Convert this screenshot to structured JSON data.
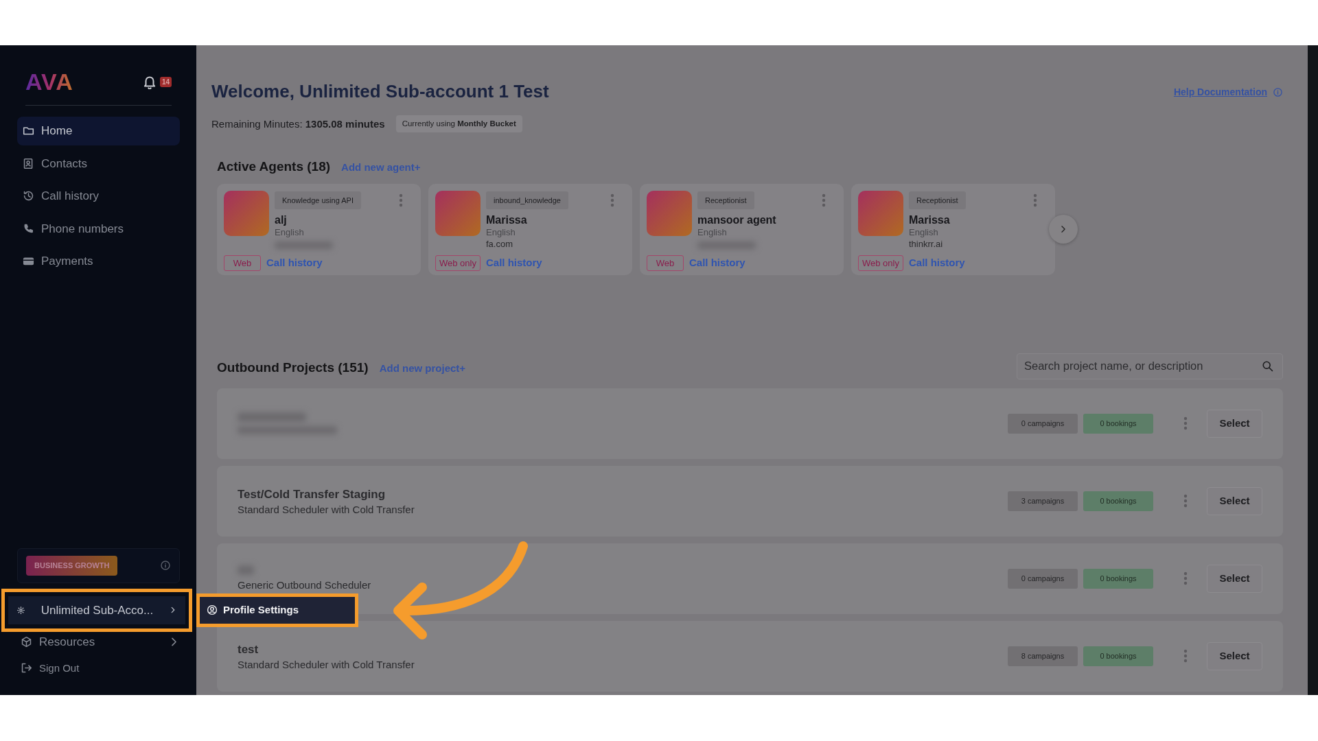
{
  "sidebar": {
    "logo": "AVA",
    "notification_count": "14",
    "nav": [
      {
        "label": "Home",
        "selected": true
      },
      {
        "label": "Contacts",
        "selected": false
      },
      {
        "label": "Call history",
        "selected": false
      },
      {
        "label": "Phone numbers",
        "selected": false
      },
      {
        "label": "Payments",
        "selected": false
      }
    ],
    "plan_badge": "BUSINESS GROWTH",
    "account": {
      "label": "Unlimited Sub-Acco...",
      "expanded": true,
      "highlighted": true
    },
    "submenu": [
      {
        "label": "Profile Settings",
        "highlighted": true
      }
    ],
    "footer_items": [
      {
        "label": "Resources",
        "kind": "submenu"
      },
      {
        "label": "Sign Out",
        "kind": "action"
      }
    ]
  },
  "header": {
    "title": "Welcome, Unlimited Sub-account 1 Test",
    "help_link": "Help Documentation",
    "remaining": "Remaining Minutes: **1305.08 minutes**",
    "bucket": "Currently using **Monthly Bucket**"
  },
  "agents": {
    "title": "Active Agents (18)",
    "add_link": "Add new agent+",
    "items": [
      {
        "tag": "Knowledge using API",
        "name": "alj",
        "language": "English",
        "channel": "Web",
        "call_history": "Call history"
      },
      {
        "tag": "inbound_knowledge",
        "name": "Marissa",
        "language": "English",
        "domain": "fa.com",
        "channel": "Web only",
        "call_history": "Call history"
      },
      {
        "tag": "Receptionist",
        "name": "mansoor agent",
        "language": "English",
        "channel": "Web",
        "call_history": "Call history"
      },
      {
        "tag": "Receptionist",
        "name": "Marissa",
        "language": "English",
        "domain": "thinkrr.ai",
        "channel": "Web only",
        "call_history": "Call history"
      }
    ]
  },
  "projects": {
    "title": "Outbound Projects (151)",
    "add_link": "Add new project+",
    "search": {
      "placeholder": "Search project name, or description"
    },
    "items": [
      {
        "campaigns": "0 campaigns",
        "bookings": "0 bookings",
        "action": "Select"
      },
      {
        "name": "Test/Cold Transfer Staging",
        "description": "Standard Scheduler with Cold Transfer",
        "campaigns": "3 campaigns",
        "bookings": "0 bookings",
        "action": "Select"
      },
      {
        "description": "Generic Outbound Scheduler",
        "campaigns": "0 campaigns",
        "bookings": "0 bookings",
        "action": "Select"
      },
      {
        "name": "test",
        "description": "Standard Scheduler with Cold Transfer",
        "campaigns": "8 campaigns",
        "bookings": "0 bookings",
        "action": "Select"
      }
    ]
  }
}
